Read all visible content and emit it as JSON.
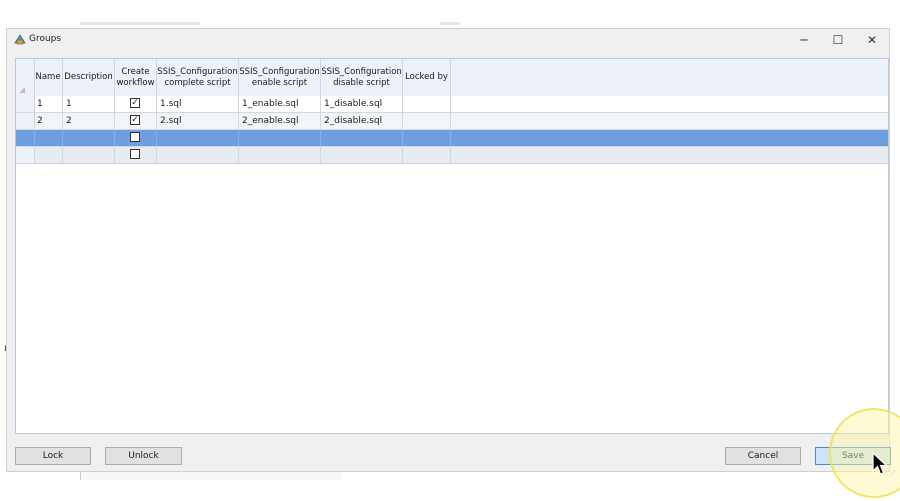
{
  "window": {
    "title": "Groups"
  },
  "titlebar": {
    "minimize": "─",
    "maximize": "☐",
    "close": "✕"
  },
  "grid": {
    "columns": [
      "Name",
      "Description",
      "Create workflow",
      "SSIS_Configuration complete script",
      "SSIS_Configuration enable script",
      "SSIS_Configuration disable script",
      "Locked by"
    ],
    "rows": [
      {
        "name": "1",
        "description": "1",
        "create_workflow": true,
        "complete_script": "1.sql",
        "enable_script": "1_enable.sql",
        "disable_script": "1_disable.sql",
        "locked_by": ""
      },
      {
        "name": "2",
        "description": "2",
        "create_workflow": true,
        "complete_script": "2.sql",
        "enable_script": "2_enable.sql",
        "disable_script": "2_disable.sql",
        "locked_by": ""
      },
      {
        "name": "",
        "description": "",
        "create_workflow": false,
        "complete_script": "",
        "enable_script": "",
        "disable_script": "",
        "locked_by": ""
      },
      {
        "name": "",
        "description": "",
        "create_workflow": false,
        "complete_script": "",
        "enable_script": "",
        "disable_script": "",
        "locked_by": ""
      }
    ],
    "check_glyph": "✓"
  },
  "buttons": {
    "lock": "Lock",
    "unlock": "Unlock",
    "cancel": "Cancel",
    "save": "Save"
  },
  "background": {
    "left_mark": "ı"
  },
  "colors": {
    "selection": "#6f9fde",
    "header": "#edf2f8",
    "save_border": "#4b8ad6",
    "highlight": "#f6ef9a"
  }
}
